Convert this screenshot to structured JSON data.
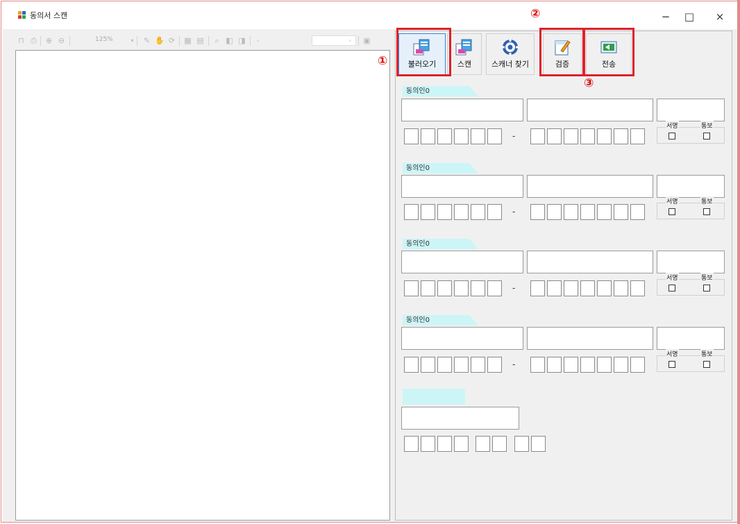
{
  "window": {
    "title": "동의서 스캔",
    "controls": {
      "minimize": "−",
      "maximize": "□",
      "close": "×"
    }
  },
  "viewer_toolbar": {
    "zoom": "125%",
    "icons": [
      "first-page-icon",
      "print-icon",
      "zoom-in-icon",
      "zoom-out-icon",
      "select-icon",
      "hand-icon",
      "rotate-icon",
      "fit-page-icon",
      "fit-width-icon",
      "search-icon",
      "prev-page-icon",
      "next-page-icon",
      "save-icon"
    ]
  },
  "toolbar": {
    "buttons": [
      {
        "label": "불러오기",
        "icon": "load-icon"
      },
      {
        "label": "스캔",
        "icon": "scan-icon"
      },
      {
        "label": "스캐너 찾기",
        "icon": "gear-icon"
      },
      {
        "label": "검증",
        "icon": "verify-icon"
      },
      {
        "label": "전송",
        "icon": "send-icon"
      }
    ]
  },
  "callouts": {
    "c1": "①",
    "c2": "②",
    "c3": "③"
  },
  "consenters": [
    {
      "tab": "동의인0",
      "separator": "-",
      "sign": "서명",
      "notify": "통보"
    },
    {
      "tab": "동의인0",
      "separator": "-",
      "sign": "서명",
      "notify": "통보"
    },
    {
      "tab": "동의인0",
      "separator": "-",
      "sign": "서명",
      "notify": "통보"
    },
    {
      "tab": "동의인0",
      "separator": "-",
      "sign": "서명",
      "notify": "통보"
    }
  ],
  "colors": {
    "accent_red": "#e0202a",
    "tab_cyan": "#ccf5f7"
  }
}
